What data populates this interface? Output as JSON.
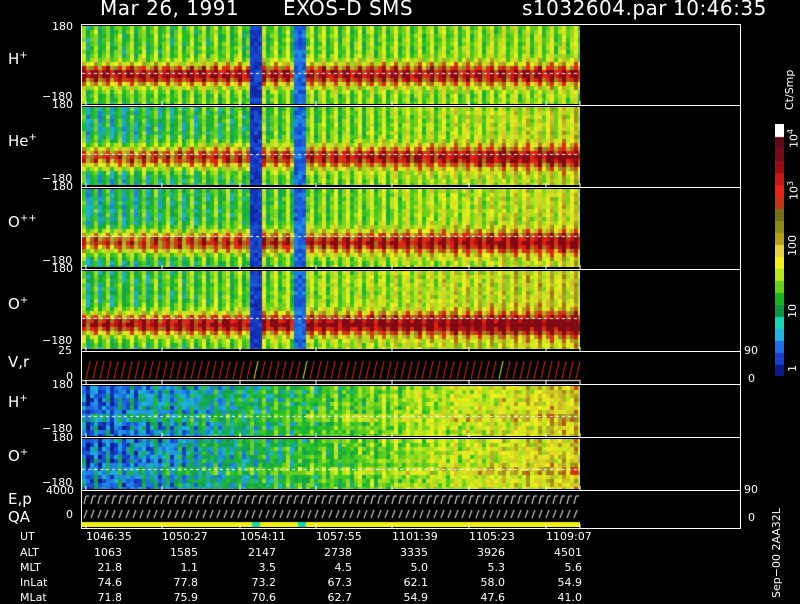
{
  "header": {
    "date": "Mar 26, 1991",
    "instrument": "EXOS-D SMS",
    "file": "s1032604.par",
    "time": "10:46:35"
  },
  "colorbar": {
    "title": "Ct/Smp",
    "labels": [
      "1",
      "10",
      "100",
      "10",
      "10"
    ],
    "label_exponents": [
      "",
      "",
      "",
      "3",
      "4"
    ],
    "colors": [
      "#0a1a8c",
      "#1a3cd0",
      "#1e6ef0",
      "#1eb4e6",
      "#14d7b4",
      "#0a9640",
      "#14b41e",
      "#64d214",
      "#b4e614",
      "#f0f014",
      "#e6d23c",
      "#b4a014",
      "#8c8c14",
      "#786e14",
      "#c83214",
      "#f01e14",
      "#c81414",
      "#a00a14",
      "#780a14",
      "#640a14",
      "#ffffff"
    ]
  },
  "panels": [
    {
      "label": "H",
      "sup": "+",
      "ytop": "180",
      "ybot": "−180"
    },
    {
      "label": "He",
      "sup": "+",
      "ytop": "180",
      "ybot": "−180"
    },
    {
      "label": "O",
      "sup": "++",
      "ytop": "180",
      "ybot": "−180"
    },
    {
      "label": "O",
      "sup": "+",
      "ytop": "180",
      "ybot": "−180"
    },
    {
      "label": "V,r",
      "sup": "",
      "ytop": "25",
      "ybot": "0",
      "rtop": "90",
      "rbot": "0"
    },
    {
      "label": "H",
      "sup": "+",
      "ytop": "180",
      "ybot": "−180"
    },
    {
      "label": "O",
      "sup": "+",
      "ytop": "180",
      "ybot": "−180"
    },
    {
      "label": "E,p",
      "sup": "",
      "label2": "QA",
      "ytop": "4000",
      "ybot": "0",
      "rtop": "90",
      "rbot": "0"
    }
  ],
  "footer": {
    "rows": [
      {
        "name": "UT",
        "values": [
          "1046:35",
          "1050:27",
          "1054:11",
          "1057:55",
          "1101:39",
          "1105:23",
          "1109:07"
        ]
      },
      {
        "name": "ALT",
        "values": [
          "1063",
          "1585",
          "2147",
          "2738",
          "3335",
          "3926",
          "4501"
        ]
      },
      {
        "name": "MLT",
        "values": [
          "21.8",
          "1.1",
          "3.5",
          "4.5",
          "5.0",
          "5.3",
          "5.6"
        ]
      },
      {
        "name": "InLat",
        "values": [
          "74.6",
          "77.8",
          "73.2",
          "67.3",
          "62.1",
          "58.0",
          "54.9"
        ]
      },
      {
        "name": "MLat",
        "values": [
          "71.8",
          "75.9",
          "70.6",
          "62.7",
          "54.9",
          "47.6",
          "41.0"
        ]
      }
    ],
    "stamp": "Sep−00  2AA32L"
  },
  "chart_data": {
    "type": "heatmap",
    "title": "Mar 26, 1991   EXOS-D SMS",
    "xlabel": "UT",
    "x_ticks": [
      "1046:35",
      "1050:27",
      "1054:11",
      "1057:55",
      "1101:39",
      "1105:23",
      "1109:07"
    ],
    "series": [
      {
        "name": "H+",
        "ylim": [
          -180,
          180
        ]
      },
      {
        "name": "He+",
        "ylim": [
          -180,
          180
        ]
      },
      {
        "name": "O++",
        "ylim": [
          -180,
          180
        ]
      },
      {
        "name": "O+",
        "ylim": [
          -180,
          180
        ]
      },
      {
        "name": "V,r",
        "ylim": [
          0,
          25
        ],
        "right_ylim": [
          0,
          90
        ]
      },
      {
        "name": "H+",
        "ylim": [
          -180,
          180
        ]
      },
      {
        "name": "O+",
        "ylim": [
          -180,
          180
        ]
      },
      {
        "name": "E,p",
        "ylim": [
          0,
          4000
        ],
        "right_ylim": [
          0,
          90
        ]
      }
    ],
    "colorbar_units": "Ct/Smp",
    "color_scale": "log",
    "color_range": [
      1,
      10000
    ]
  }
}
